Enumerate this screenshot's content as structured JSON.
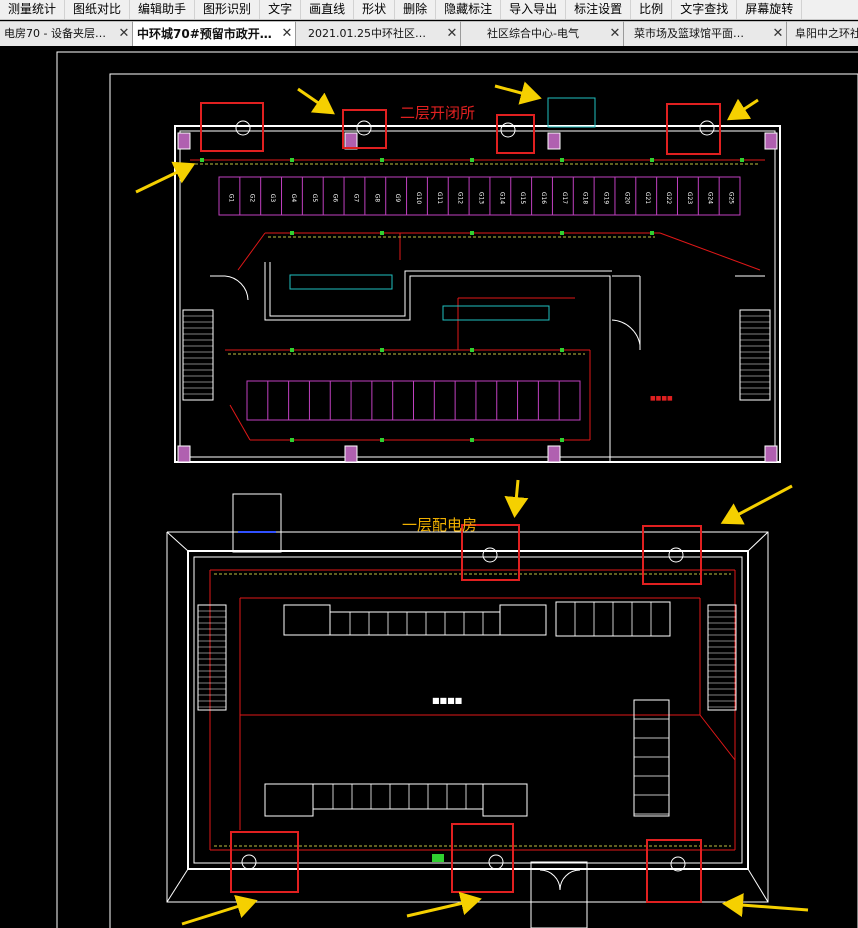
{
  "menu": {
    "items": [
      "测量统计",
      "图纸对比",
      "编辑助手",
      "图形识别",
      "文字",
      "画直线",
      "形状",
      "删除",
      "隐藏标注",
      "导入导出",
      "标注设置",
      "比例",
      "文字查找",
      "屏幕旋转"
    ]
  },
  "tabs": [
    {
      "label": "电房70 - 设备夹层…",
      "active": false
    },
    {
      "label": "中环城70#预留市政开…",
      "active": true
    },
    {
      "label": "2021.01.25中环社区…",
      "active": false
    },
    {
      "label": "社区综合中心-电气",
      "active": false
    },
    {
      "label": "菜市场及篮球馆平面…",
      "active": false
    },
    {
      "label": "阜阳中之环社区",
      "active": false
    }
  ],
  "drawing": {
    "upper_title": "二层开闭所",
    "lower_title": "一层配电房",
    "upper_cabinets": [
      "G1",
      "G2",
      "G3",
      "G4",
      "G5",
      "G6",
      "G7",
      "G8",
      "G9",
      "G10",
      "G11",
      "G12",
      "G13",
      "G14",
      "G15",
      "G16",
      "G17",
      "G18",
      "G19",
      "G20",
      "G21",
      "G22",
      "G23",
      "G24",
      "G25"
    ],
    "colors": {
      "background": "#000000",
      "wall": "#ffffff",
      "highlight_box": "#e02020",
      "arrow": "#f5d000",
      "cabinet": "#c040c0",
      "equipment": "#20c0c0",
      "cable": "#e01818",
      "title_upper": "#e02020",
      "title_lower": "#f0b000"
    }
  }
}
